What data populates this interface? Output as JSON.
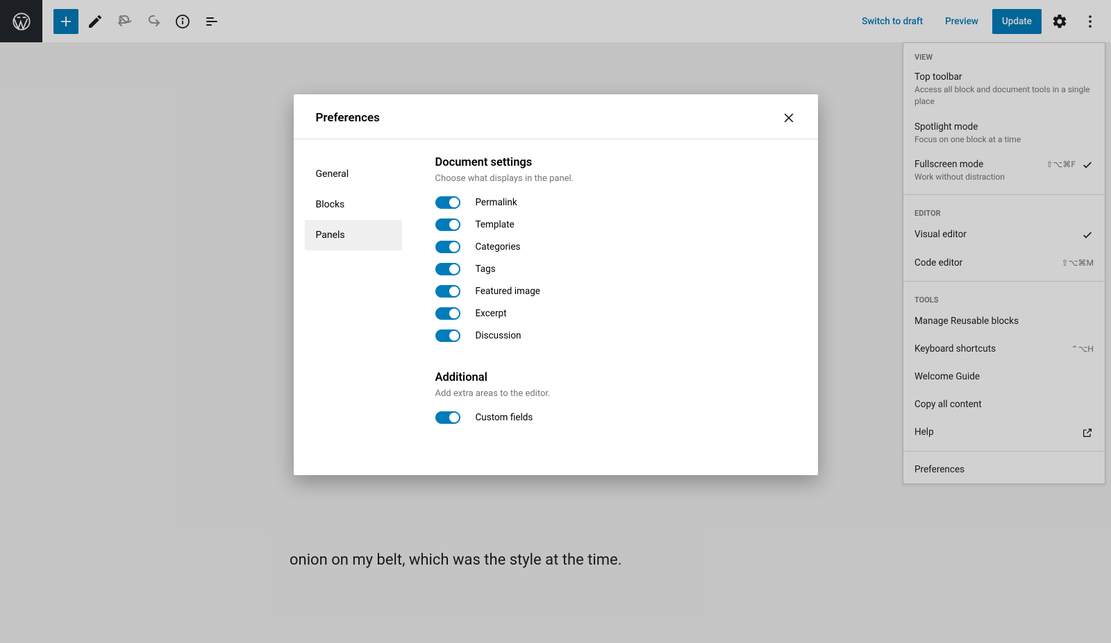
{
  "topbar": {
    "switch_to_draft": "Switch to draft",
    "preview": "Preview",
    "update": "Update"
  },
  "dropdown": {
    "sections": {
      "view": "View",
      "editor": "Editor",
      "tools": "Tools"
    },
    "top_toolbar": {
      "label": "Top toolbar",
      "desc": "Access all block and document tools in a single place"
    },
    "spotlight": {
      "label": "Spotlight mode",
      "desc": "Focus on one block at a time"
    },
    "fullscreen": {
      "label": "Fullscreen mode",
      "desc": "Work without distraction",
      "shortcut": "⇧⌥⌘F"
    },
    "visual_editor": {
      "label": "Visual editor"
    },
    "code_editor": {
      "label": "Code editor",
      "shortcut": "⇧⌥⌘M"
    },
    "manage_blocks": "Manage Reusable blocks",
    "keyboard_shortcuts": {
      "label": "Keyboard shortcuts",
      "shortcut": "⌃⌥H"
    },
    "welcome_guide": "Welcome Guide",
    "copy_all": "Copy all content",
    "help": "Help",
    "preferences": "Preferences"
  },
  "modal": {
    "title": "Preferences",
    "nav": {
      "general": "General",
      "blocks": "Blocks",
      "panels": "Panels"
    },
    "doc_settings": {
      "title": "Document settings",
      "desc": "Choose what displays in the panel."
    },
    "toggles": {
      "permalink": "Permalink",
      "template": "Template",
      "categories": "Categories",
      "tags": "Tags",
      "featured_image": "Featured image",
      "excerpt": "Excerpt",
      "discussion": "Discussion"
    },
    "additional": {
      "title": "Additional",
      "desc": "Add extra areas to the editor."
    },
    "additional_toggles": {
      "custom_fields": "Custom fields"
    }
  },
  "content_text": "onion on my belt, which was the style at the time."
}
